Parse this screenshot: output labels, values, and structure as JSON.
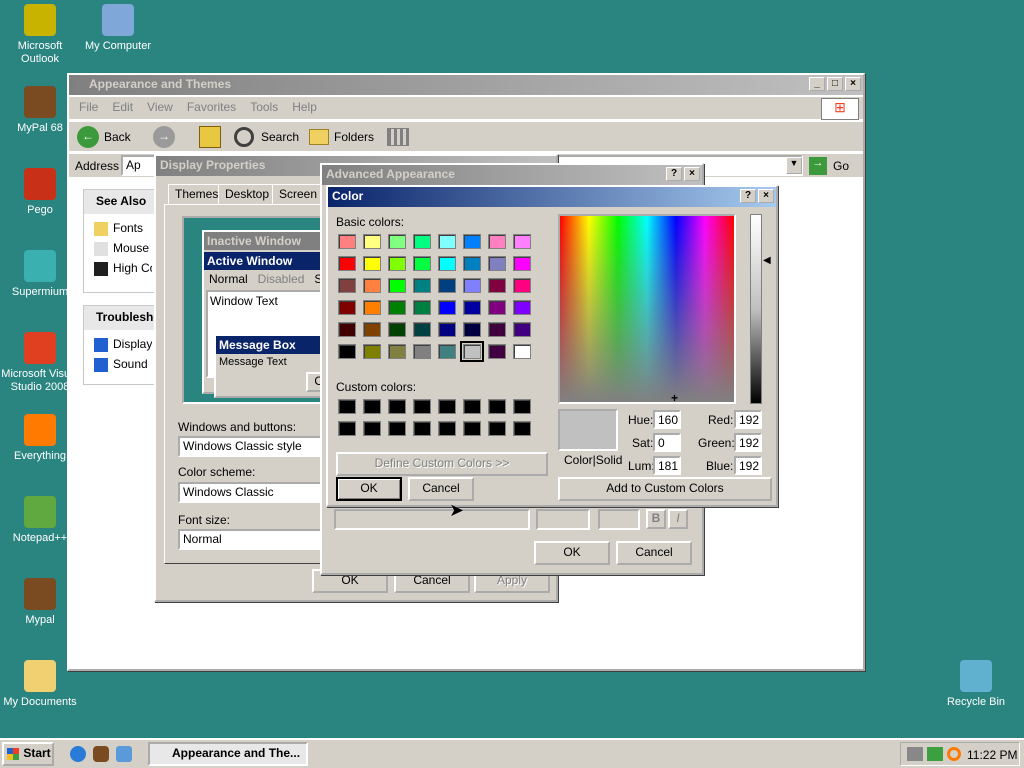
{
  "desktop": {
    "icons": [
      {
        "label": "Microsoft Outlook",
        "icon": "outlook-icon",
        "color": "#c8b400"
      },
      {
        "label": "My Computer",
        "icon": "computer-icon",
        "color": "#7fa8d8"
      },
      {
        "label": "MyPal 68",
        "icon": "raccoon-icon",
        "color": "#7a4a20"
      },
      {
        "label": "Pego",
        "icon": "pego-icon",
        "color": "#c83018"
      },
      {
        "label": "Supermium",
        "icon": "browser-icon",
        "color": "#3ab0b0"
      },
      {
        "label": "Microsoft Visual Studio 2008",
        "icon": "visual-studio-icon",
        "color": "#e04020"
      },
      {
        "label": "Everything",
        "icon": "search-app-icon",
        "color": "#ff7a00"
      },
      {
        "label": "Notepad++",
        "icon": "notepad-icon",
        "color": "#60a840"
      },
      {
        "label": "Mypal",
        "icon": "raccoon-icon",
        "color": "#7a4a20"
      },
      {
        "label": "My Documents",
        "icon": "folder-icon",
        "color": "#f0d070"
      },
      {
        "label": "Recycle Bin",
        "icon": "recycle-bin-icon",
        "color": "#60b0d0"
      }
    ]
  },
  "explorer": {
    "title": "Appearance and Themes",
    "menu": [
      "File",
      "Edit",
      "View",
      "Favorites",
      "Tools",
      "Help"
    ],
    "toolbar": {
      "back": "Back",
      "search": "Search",
      "folders": "Folders"
    },
    "address_label": "Address",
    "address_value": "Ap",
    "go": "Go",
    "see_also": {
      "title": "See Also",
      "items": [
        "Fonts",
        "Mouse",
        "High Co"
      ]
    },
    "troubleshooters": {
      "title": "Troublesho",
      "items": [
        "Display",
        "Sound"
      ]
    }
  },
  "display_properties": {
    "title": "Display Properties",
    "tabs": [
      "Themes",
      "Desktop",
      "Screen Sa"
    ],
    "preview": {
      "inactive": "Inactive Window",
      "active": "Active Window",
      "menu": [
        "Normal",
        "Disabled",
        "Se"
      ],
      "window_text": "Window Text",
      "message_box": "Message Box",
      "message_text": "Message Text",
      "ok": "OK"
    },
    "windows_buttons_label": "Windows and buttons:",
    "windows_buttons_value": "Windows Classic style",
    "color_scheme_label": "Color scheme:",
    "color_scheme_value": "Windows Classic",
    "font_size_label": "Font size:",
    "font_size_value": "Normal",
    "buttons": {
      "ok": "OK",
      "cancel": "Cancel",
      "apply": "Apply"
    }
  },
  "advanced": {
    "title": "Advanced Appearance",
    "ok": "OK",
    "cancel": "Cancel",
    "bold": "B",
    "italic": "I"
  },
  "color_dialog": {
    "title": "Color",
    "basic_label": "Basic colors:",
    "custom_label": "Custom colors:",
    "define_custom": "Define Custom Colors >>",
    "ok": "OK",
    "cancel": "Cancel",
    "add_custom": "Add to Custom Colors",
    "color_solid": "Color|Solid",
    "hue_label": "Hue:",
    "hue": "160",
    "sat_label": "Sat:",
    "sat": "0",
    "lum_label": "Lum:",
    "lum": "181",
    "red_label": "Red:",
    "red": "192",
    "green_label": "Green:",
    "green": "192",
    "blue_label": "Blue:",
    "blue": "192",
    "selected_color": "#c0c0c0",
    "basic_colors": [
      "#ff8080",
      "#ffff80",
      "#80ff80",
      "#00ff80",
      "#80ffff",
      "#0080ff",
      "#ff80c0",
      "#ff80ff",
      "#ff0000",
      "#ffff00",
      "#80ff00",
      "#00ff40",
      "#00ffff",
      "#0080c0",
      "#8080c0",
      "#ff00ff",
      "#804040",
      "#ff8040",
      "#00ff00",
      "#008080",
      "#004080",
      "#8080ff",
      "#800040",
      "#ff0080",
      "#800000",
      "#ff8000",
      "#008000",
      "#008040",
      "#0000ff",
      "#0000a0",
      "#800080",
      "#8000ff",
      "#400000",
      "#804000",
      "#004000",
      "#004040",
      "#000080",
      "#000040",
      "#400040",
      "#400080",
      "#000000",
      "#808000",
      "#808040",
      "#808080",
      "#408080",
      "#c0c0c0",
      "#400040",
      "#ffffff"
    ],
    "custom_colors": [
      "#000000",
      "#000000",
      "#000000",
      "#000000",
      "#000000",
      "#000000",
      "#000000",
      "#000000",
      "#000000",
      "#000000",
      "#000000",
      "#000000",
      "#000000",
      "#000000",
      "#000000",
      "#000000"
    ]
  },
  "taskbar": {
    "start": "Start",
    "task": "Appearance and The...",
    "clock": "11:22 PM"
  }
}
